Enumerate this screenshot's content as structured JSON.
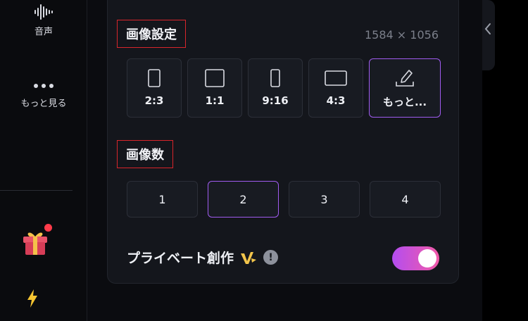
{
  "sidebar": {
    "items": [
      {
        "label": "音声",
        "icon": "waveform-icon"
      },
      {
        "label": "もっと見る",
        "icon": "more-dots-icon"
      }
    ],
    "gift": {
      "icon": "gift-icon",
      "has_notification": true
    },
    "bolt": {
      "icon": "lightning-icon"
    }
  },
  "image_settings": {
    "title": "画像設定",
    "dimensions": "1584 × 1056",
    "ratios": [
      {
        "label": "2:3",
        "icon": "portrait-ratio-icon",
        "selected": false
      },
      {
        "label": "1:1",
        "icon": "square-ratio-icon",
        "selected": false
      },
      {
        "label": "9:16",
        "icon": "tall-ratio-icon",
        "selected": false
      },
      {
        "label": "4:3",
        "icon": "landscape-ratio-icon",
        "selected": false
      },
      {
        "label": "もっと...",
        "icon": "custom-ratio-icon",
        "selected": true
      }
    ]
  },
  "image_count": {
    "title": "画像数",
    "options": [
      {
        "label": "1",
        "selected": false
      },
      {
        "label": "2",
        "selected": true
      },
      {
        "label": "3",
        "selected": false
      },
      {
        "label": "4",
        "selected": false
      }
    ]
  },
  "private_creation": {
    "label": "プライベート創作",
    "info_symbol": "!",
    "enabled": true
  },
  "colors": {
    "accent": "#a05cf0",
    "toggle_start": "#b44df0",
    "toggle_end": "#f25aa8",
    "highlight_box": "#d8252b"
  }
}
